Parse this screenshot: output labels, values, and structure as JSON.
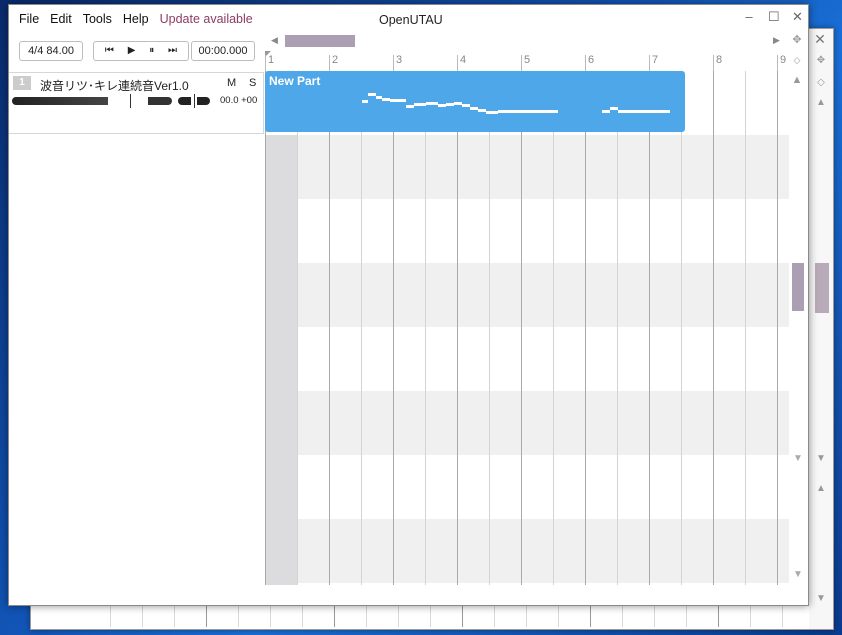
{
  "menu": {
    "file": "File",
    "edit": "Edit",
    "tools": "Tools",
    "help": "Help",
    "update": "Update available"
  },
  "window": {
    "title": "OpenUTAU"
  },
  "toolbar": {
    "time_signature_bpm": "4/4  84.00",
    "time_display": "00:00.000"
  },
  "track": {
    "number": "1",
    "name": "波音リツ･キレ連続音Ver1.0",
    "mute": "M",
    "solo": "S",
    "volume_pan_values": "00.0  +00",
    "volume_level": 0.65,
    "pan_level": 0.5
  },
  "ruler": {
    "bars": [
      "1",
      "2",
      "3",
      "4",
      "5",
      "6",
      "7",
      "8",
      "9"
    ]
  },
  "part": {
    "name": "New Part"
  },
  "colors": {
    "accent_scrollbar": "#ac9fb3",
    "part_fill": "#4ea7e8",
    "update_text": "#8b3d63"
  },
  "icons": {
    "skip_back": "skip-back-icon",
    "play": "play-icon",
    "pause": "pause-icon",
    "skip_forward": "skip-forward-icon",
    "scroll_left": "triangle-left-icon",
    "scroll_right": "triangle-right-icon",
    "scroll_up": "triangle-up-icon",
    "scroll_down": "triangle-down-icon"
  }
}
